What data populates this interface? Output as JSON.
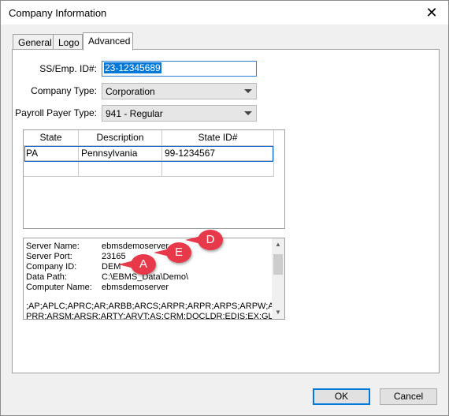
{
  "window": {
    "title": "Company Information",
    "close_icon": "close-icon"
  },
  "tabs": [
    {
      "label": "General"
    },
    {
      "label": "Logo"
    },
    {
      "label": "Advanced"
    }
  ],
  "form": {
    "ssn_label": "SS/Emp. ID#:",
    "ssn_value": "23-12345689",
    "company_type_label": "Company Type:",
    "company_type_value": "Corporation",
    "payroll_payer_label": "Payroll Payer Type:",
    "payroll_payer_value": "941  - Regular"
  },
  "state_grid": {
    "columns": [
      "State",
      "Description",
      "State ID#"
    ],
    "rows": [
      [
        "PA",
        "Pennsylvania",
        "99-1234567"
      ],
      [
        "",
        "",
        ""
      ]
    ]
  },
  "server_info": {
    "lines": [
      {
        "label": "Server Name:",
        "value": "ebmsdemoserver"
      },
      {
        "label": "Server Port:",
        "value": "23165"
      },
      {
        "label": "Company ID:",
        "value": "DEM"
      },
      {
        "label": "Data Path:",
        "value": "C:\\EBMS_Data\\Demo\\"
      },
      {
        "label": "Computer Name:",
        "value": "ebmsdemoserver"
      }
    ],
    "modules_line": ";AP;APLC;APRC;AR;ARBB;ARCS;ARPR;ARPR;ARPS;ARPW;A",
    "modules_line2": "PRR;ARSM;ARSR;ARTY;ARVT;AS;CRM;DOCLDR;EDIS;EX;GL;"
  },
  "callouts": [
    "D",
    "E",
    "A"
  ],
  "buttons": {
    "ok": "OK",
    "cancel": "Cancel"
  },
  "colors": {
    "accent": "#0078d7",
    "callout": "#e8394a"
  }
}
